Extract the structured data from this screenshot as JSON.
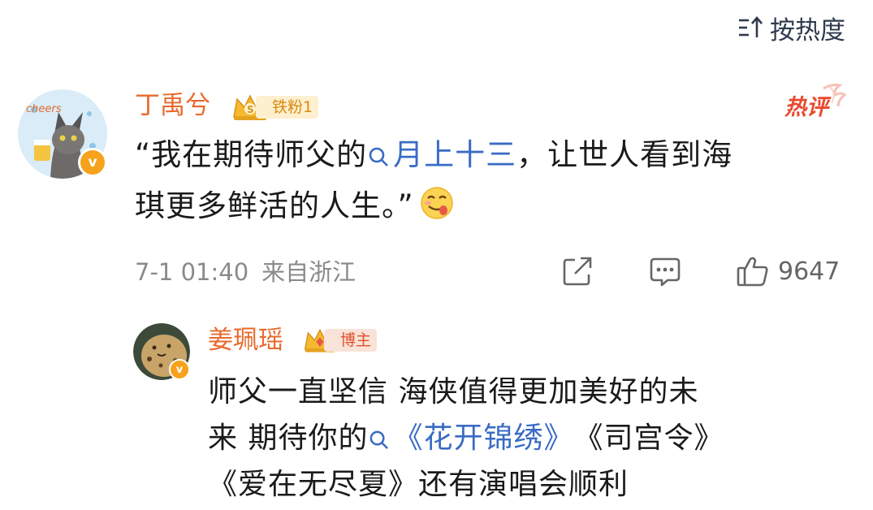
{
  "sort": {
    "label": "按热度",
    "icon": "sort-arrows-icon"
  },
  "comment": {
    "author": "丁禹兮",
    "fan_badge": "铁粉1",
    "hot_label": "热评",
    "text_before": "“我在期待师父的",
    "topic": "月上十三",
    "text_line1_after": "，让世人看到海",
    "text_line2": "琪更多鲜活的人生。”",
    "emoji": "drooling-face-emoji",
    "date": "7-1 01:40",
    "location": "来自浙江",
    "likes": "9647",
    "verified_badge": "v"
  },
  "reply": {
    "author": "姜珮瑶",
    "badge": "博主",
    "line1": "师父一直坚信 海侠值得更加美好的未",
    "line2_before": "来 期待你的",
    "topic": "《花开锦绣》",
    "line2_after": "《司宫令》",
    "line3": "《爱在无尽夏》还有演唱会顺利",
    "verified_badge": "v"
  },
  "colors": {
    "name": "#e8692d",
    "topic": "#3a6bc4",
    "hot": "#e8492f",
    "badge_bg": "#fdf0cf",
    "badge_text": "#d98a12"
  }
}
